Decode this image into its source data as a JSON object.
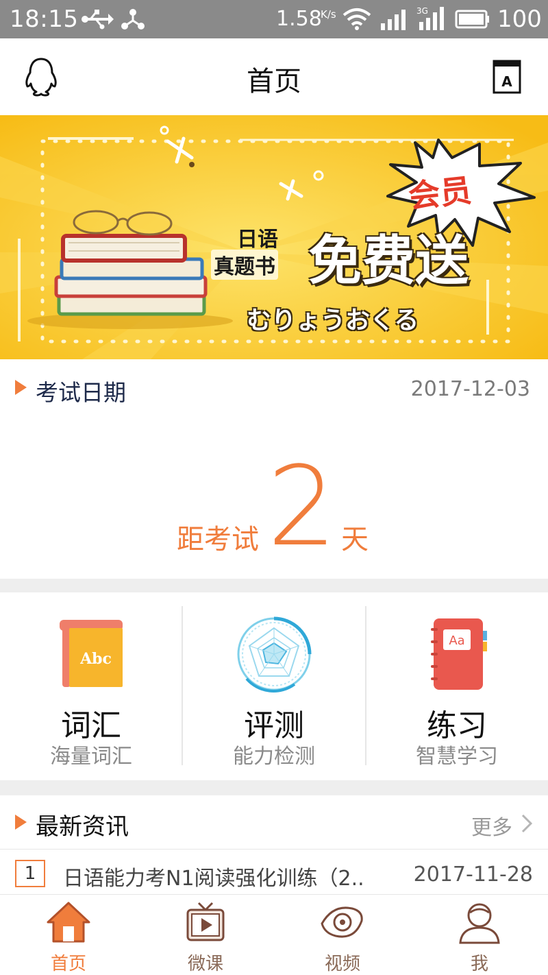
{
  "status_bar": {
    "time": "18:15",
    "network_speed": "1.58",
    "network_speed_unit": "K/s",
    "battery": "100",
    "icons": [
      "usb-icon",
      "share-icon",
      "wifi-icon",
      "signal-icon",
      "3g-signal-icon",
      "battery-icon"
    ]
  },
  "header": {
    "title": "首页",
    "left_icon": "qq-penguin-icon",
    "right_icon": "dictionary-icon"
  },
  "banner": {
    "badge": "会员",
    "line1a": "日语",
    "line1b": "真题书",
    "headline": "免费送",
    "kana": "むりょうおくる"
  },
  "exam": {
    "label": "考试日期",
    "date": "2017-12-03",
    "countdown_prefix": "距考试",
    "countdown_days": "2",
    "countdown_suffix": "天"
  },
  "features": [
    {
      "title": "词汇",
      "subtitle": "海量词汇",
      "icon": "vocabulary-book-icon",
      "icon_text": "Abc"
    },
    {
      "title": "评测",
      "subtitle": "能力检测",
      "icon": "radar-chart-icon"
    },
    {
      "title": "练习",
      "subtitle": "智慧学习",
      "icon": "notebook-icon",
      "icon_text": "Aa"
    }
  ],
  "news": {
    "title": "最新资讯",
    "more": "更多",
    "items": [
      {
        "rank": "1",
        "text": "日语能力考N1阅读强化训练（2..",
        "date": "2017-11-28"
      }
    ]
  },
  "tabs": [
    {
      "label": "首页",
      "icon": "home-icon",
      "active": true
    },
    {
      "label": "微课",
      "icon": "tv-play-icon",
      "active": false
    },
    {
      "label": "视频",
      "icon": "eye-icon",
      "active": false
    },
    {
      "label": "我",
      "icon": "user-icon",
      "active": false
    }
  ],
  "colors": {
    "accent": "#f07d3c",
    "banner_bg": "#f8c22a",
    "status_bar": "#8a8a8a",
    "divider": "#eeeeee"
  }
}
